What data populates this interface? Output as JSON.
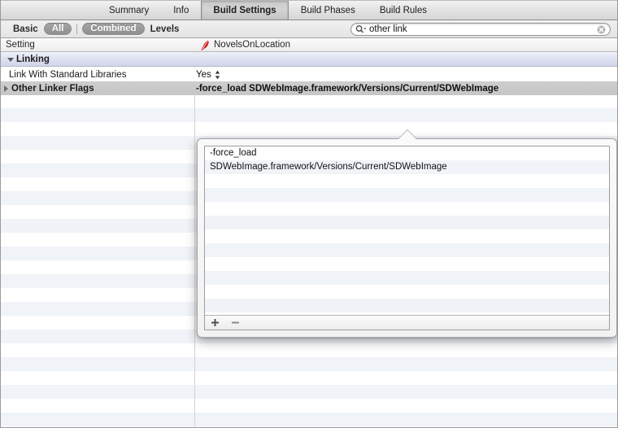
{
  "tabs": [
    {
      "label": "Summary",
      "selected": false
    },
    {
      "label": "Info",
      "selected": false
    },
    {
      "label": "Build Settings",
      "selected": true
    },
    {
      "label": "Build Phases",
      "selected": false
    },
    {
      "label": "Build Rules",
      "selected": false
    }
  ],
  "filter_bar": {
    "scope": [
      {
        "label": "Basic",
        "selected": false
      },
      {
        "label": "All",
        "selected": true
      }
    ],
    "mode": [
      {
        "label": "Combined",
        "selected": true
      },
      {
        "label": "Levels",
        "selected": false
      }
    ],
    "search": {
      "value": "other link",
      "placeholder": "Search",
      "search_icon": "search-icon",
      "clear_icon": "clear-icon"
    }
  },
  "table": {
    "columns": {
      "setting": "Setting",
      "target": "NovelsOnLocation",
      "target_icon": "quill-icon"
    },
    "group": {
      "label": "Linking",
      "expanded": true,
      "disclosure_icon": "triangle-down-icon"
    },
    "rows": [
      {
        "name": "Link With Standard Libraries",
        "value": "Yes",
        "has_stepper": true,
        "selected": false,
        "expandable": false
      },
      {
        "name": "Other Linker Flags",
        "value": "-force_load SDWebImage.framework/Versions/Current/SDWebImage",
        "has_stepper": false,
        "selected": true,
        "expandable": true,
        "disclosure_icon": "triangle-right-icon"
      }
    ]
  },
  "popover": {
    "items": [
      "-force_load",
      "SDWebImage.framework/Versions/Current/SDWebImage"
    ],
    "toolbar": {
      "add_label": "+",
      "remove_label": "−",
      "add_icon": "plus-icon",
      "remove_icon": "minus-icon"
    }
  },
  "colors": {
    "selected_row": "#c8c8c8",
    "group_row": "#dcdff0",
    "stripe": "#f0f3f8",
    "target_icon": "#cc2222"
  }
}
